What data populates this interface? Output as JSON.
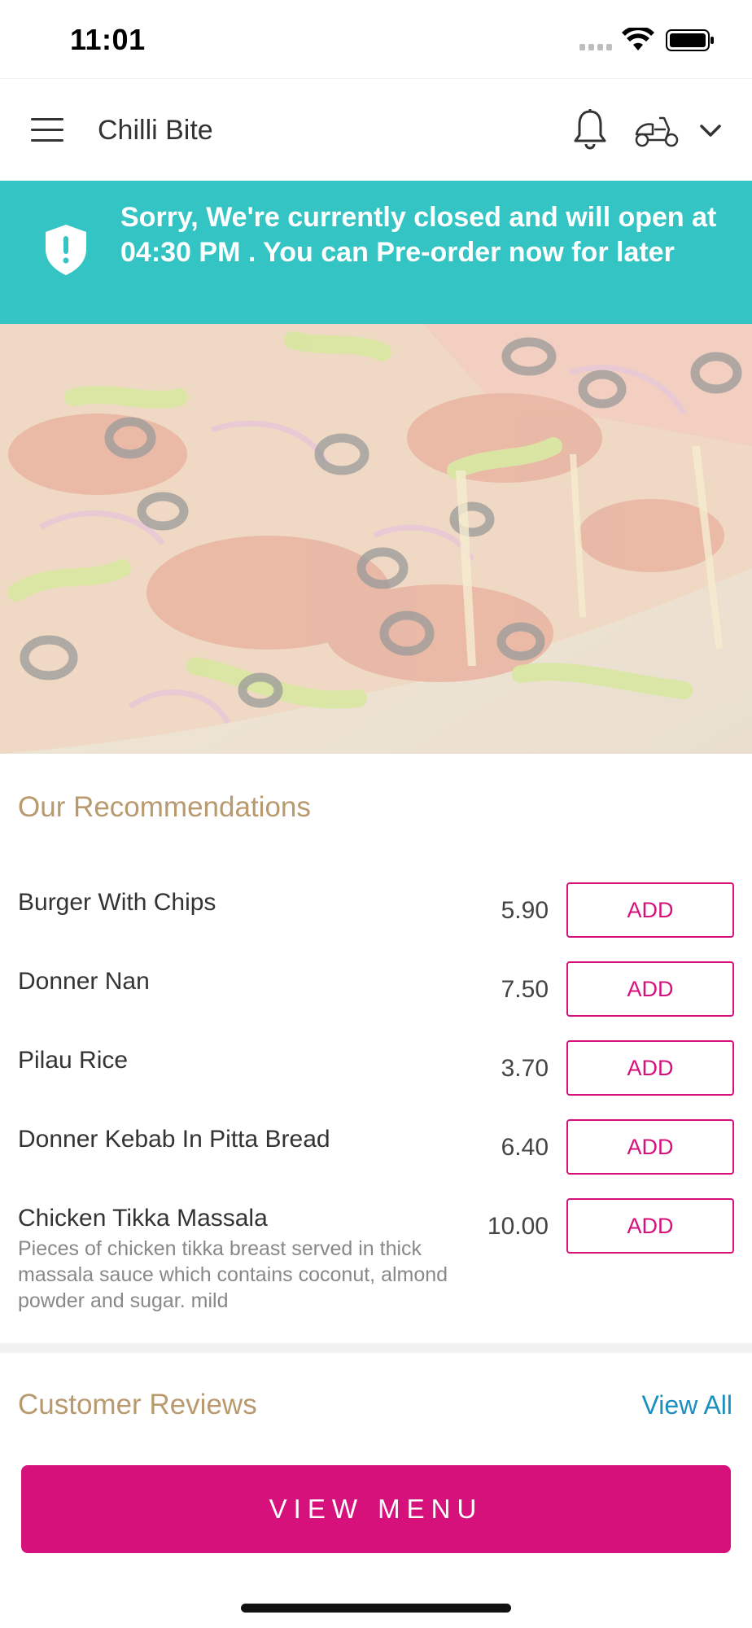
{
  "status_bar": {
    "time": "11:01"
  },
  "header": {
    "title": "Chilli Bite",
    "icons": [
      "hamburger-menu-icon",
      "bell-icon",
      "scooter-icon",
      "chevron-down-icon"
    ]
  },
  "notice": {
    "text": "Sorry, We're currently closed and will open at 04:30 PM . You can Pre-order now for later",
    "icon": "shield-alert-icon",
    "color": "#35c4c4"
  },
  "hero": {
    "image": "pizza-photo"
  },
  "recommendations": {
    "title": "Our Recommendations",
    "items": [
      {
        "name": "Burger With Chips",
        "description": "",
        "price": "5.90",
        "button": "ADD"
      },
      {
        "name": "Donner Nan",
        "description": "",
        "price": "7.50",
        "button": "ADD"
      },
      {
        "name": "Pilau Rice",
        "description": "",
        "price": "3.70",
        "button": "ADD"
      },
      {
        "name": "Donner Kebab In Pitta Bread",
        "description": "",
        "price": "6.40",
        "button": "ADD"
      },
      {
        "name": "Chicken Tikka Massala",
        "description": "Pieces of chicken tikka breast served in thick massala sauce which contains coconut, almond powder and sugar. mild",
        "price": "10.00",
        "button": "ADD"
      }
    ]
  },
  "reviews": {
    "title": "Customer Reviews",
    "view_all": "View All"
  },
  "footer": {
    "view_menu": "VIEW MENU"
  },
  "colors": {
    "accent": "#d6117c",
    "section_title": "#b89a6e",
    "link": "#1a8fc0",
    "banner": "#35c4c4"
  }
}
